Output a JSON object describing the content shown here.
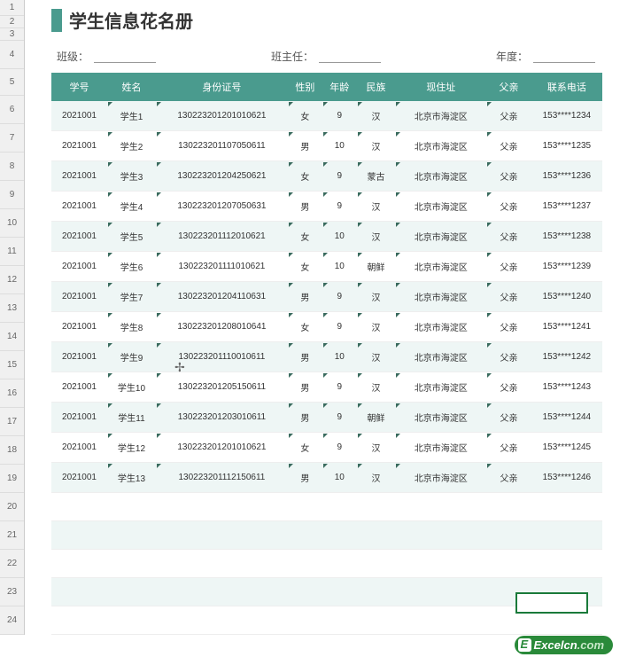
{
  "title": "学生信息花名册",
  "filters": {
    "class_label": "班级：",
    "teacher_label": "班主任：",
    "year_label": "年度："
  },
  "headers": [
    "学号",
    "姓名",
    "身份证号",
    "性别",
    "年龄",
    "民族",
    "现住址",
    "父亲",
    "联系电话"
  ],
  "row_numbers": [
    "1",
    "2",
    "3",
    "4",
    "5",
    "6",
    "7",
    "8",
    "9",
    "10",
    "11",
    "12",
    "13",
    "14",
    "15",
    "16",
    "17",
    "18",
    "19",
    "20",
    "21",
    "22",
    "23",
    "24"
  ],
  "rows": [
    {
      "id": "2021001",
      "name": "学生1",
      "idcard": "130223201201010621",
      "sex": "女",
      "age": "9",
      "ethnic": "汉",
      "addr": "北京市海淀区",
      "father": "父亲",
      "phone": "153****1234"
    },
    {
      "id": "2021001",
      "name": "学生2",
      "idcard": "130223201107050611",
      "sex": "男",
      "age": "10",
      "ethnic": "汉",
      "addr": "北京市海淀区",
      "father": "父亲",
      "phone": "153****1235"
    },
    {
      "id": "2021001",
      "name": "学生3",
      "idcard": "130223201204250621",
      "sex": "女",
      "age": "9",
      "ethnic": "蒙古",
      "addr": "北京市海淀区",
      "father": "父亲",
      "phone": "153****1236"
    },
    {
      "id": "2021001",
      "name": "学生4",
      "idcard": "130223201207050631",
      "sex": "男",
      "age": "9",
      "ethnic": "汉",
      "addr": "北京市海淀区",
      "father": "父亲",
      "phone": "153****1237"
    },
    {
      "id": "2021001",
      "name": "学生5",
      "idcard": "130223201112010621",
      "sex": "女",
      "age": "10",
      "ethnic": "汉",
      "addr": "北京市海淀区",
      "father": "父亲",
      "phone": "153****1238"
    },
    {
      "id": "2021001",
      "name": "学生6",
      "idcard": "130223201111010621",
      "sex": "女",
      "age": "10",
      "ethnic": "朝鲜",
      "addr": "北京市海淀区",
      "father": "父亲",
      "phone": "153****1239"
    },
    {
      "id": "2021001",
      "name": "学生7",
      "idcard": "130223201204110631",
      "sex": "男",
      "age": "9",
      "ethnic": "汉",
      "addr": "北京市海淀区",
      "father": "父亲",
      "phone": "153****1240"
    },
    {
      "id": "2021001",
      "name": "学生8",
      "idcard": "130223201208010641",
      "sex": "女",
      "age": "9",
      "ethnic": "汉",
      "addr": "北京市海淀区",
      "father": "父亲",
      "phone": "153****1241"
    },
    {
      "id": "2021001",
      "name": "学生9",
      "idcard": "130223201110010611",
      "sex": "男",
      "age": "10",
      "ethnic": "汉",
      "addr": "北京市海淀区",
      "father": "父亲",
      "phone": "153****1242"
    },
    {
      "id": "2021001",
      "name": "学生10",
      "idcard": "130223201205150611",
      "sex": "男",
      "age": "9",
      "ethnic": "汉",
      "addr": "北京市海淀区",
      "father": "父亲",
      "phone": "153****1243"
    },
    {
      "id": "2021001",
      "name": "学生11",
      "idcard": "130223201203010611",
      "sex": "男",
      "age": "9",
      "ethnic": "朝鲜",
      "addr": "北京市海淀区",
      "father": "父亲",
      "phone": "153****1244"
    },
    {
      "id": "2021001",
      "name": "学生12",
      "idcard": "130223201201010621",
      "sex": "女",
      "age": "9",
      "ethnic": "汉",
      "addr": "北京市海淀区",
      "father": "父亲",
      "phone": "153****1245"
    },
    {
      "id": "2021001",
      "name": "学生13",
      "idcard": "130223201112150611",
      "sex": "男",
      "age": "10",
      "ethnic": "汉",
      "addr": "北京市海淀区",
      "father": "父亲",
      "phone": "153****1246"
    }
  ],
  "watermark": {
    "brand": "Excel",
    "suffix": "cn",
    "tld": ".com"
  }
}
